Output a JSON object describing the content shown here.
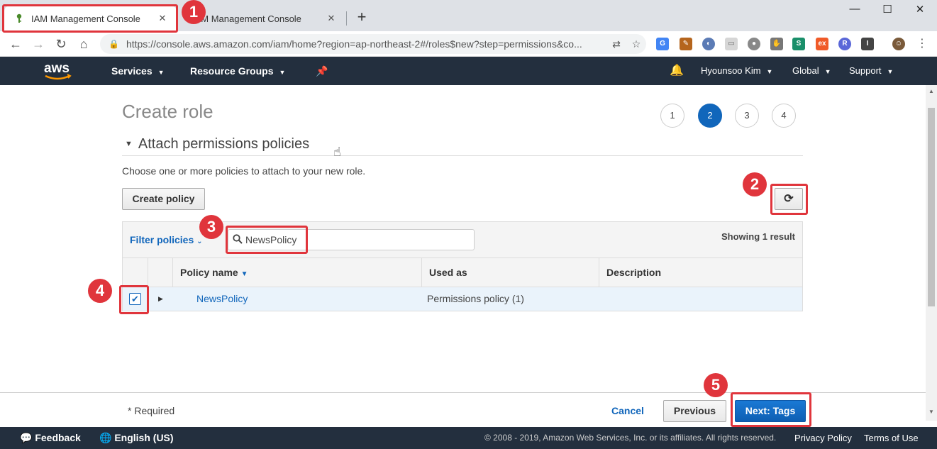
{
  "browser": {
    "tabs": [
      {
        "title": "IAM Management Console",
        "active": true
      },
      {
        "title": "IAM Management Console",
        "active": false
      }
    ],
    "close_glyph": "✕",
    "new_tab_glyph": "+",
    "url": "https://console.aws.amazon.com/iam/home?region=ap-northeast-2#/roles$new?step=permissions&co...",
    "window_controls": {
      "minimize": "—",
      "maximize": "☐",
      "close": "✕"
    }
  },
  "aws_nav": {
    "logo_text": "aws",
    "services": "Services",
    "resource_groups": "Resource Groups",
    "user": "Hyounsoo Kim",
    "region": "Global",
    "support": "Support",
    "colors": {
      "nav_bg": "#232f3e",
      "logo_smile": "#ff9900"
    }
  },
  "wizard": {
    "title": "Create role",
    "steps": [
      "1",
      "2",
      "3",
      "4"
    ],
    "current_step": "2",
    "section_title": "Attach permissions policies",
    "description": "Choose one or more policies to attach to your new role.",
    "create_policy_label": "Create policy",
    "refresh_icon": "⟳",
    "filter_label": "Filter policies",
    "search_value": "NewsPolicy",
    "result_count": "Showing 1 result",
    "table": {
      "columns": [
        "Policy name",
        "Used as",
        "Description"
      ],
      "rows": [
        {
          "checked": true,
          "name": "NewsPolicy",
          "used_as": "Permissions policy (1)",
          "description": ""
        }
      ]
    },
    "required_note": "* Required",
    "cancel_label": "Cancel",
    "previous_label": "Previous",
    "next_label": "Next: Tags"
  },
  "footer": {
    "feedback": "Feedback",
    "language": "English (US)",
    "copyright": "© 2008 - 2019, Amazon Web Services, Inc. or its affiliates. All rights reserved.",
    "privacy": "Privacy Policy",
    "terms": "Terms of Use"
  },
  "annotations": [
    "1",
    "2",
    "3",
    "4",
    "5"
  ],
  "colors": {
    "accent": "#1166bb",
    "annotation": "#e0353c"
  }
}
